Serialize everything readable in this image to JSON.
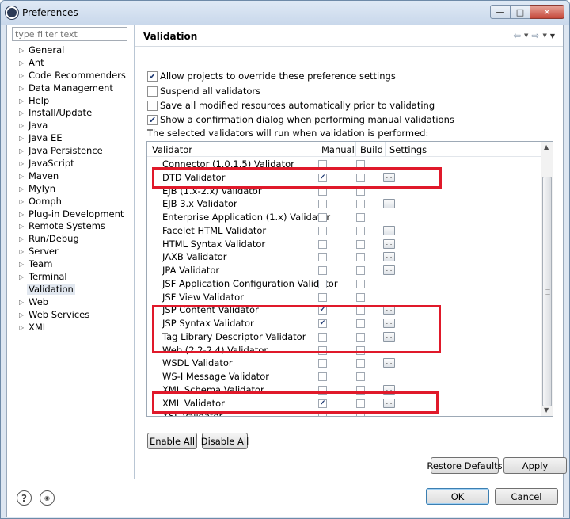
{
  "window": {
    "title": "Preferences"
  },
  "filter": {
    "placeholder": "type filter text"
  },
  "tree": [
    "General",
    "Ant",
    "Code Recommenders",
    "Data Management",
    "Help",
    "Install/Update",
    "Java",
    "Java EE",
    "Java Persistence",
    "JavaScript",
    "Maven",
    "Mylyn",
    "Oomph",
    "Plug-in Development",
    "Remote Systems",
    "Run/Debug",
    "Server",
    "Team",
    "Terminal",
    "Validation",
    "Web",
    "Web Services",
    "XML"
  ],
  "selected_tree_item": "Validation",
  "page": {
    "title": "Validation"
  },
  "options": {
    "allow_override": {
      "label": "Allow projects to override these preference settings",
      "checked": true
    },
    "suspend_all": {
      "label": "Suspend all validators",
      "checked": false
    },
    "save_all": {
      "label": "Save all modified resources automatically prior to validating",
      "checked": false
    },
    "confirm_dialog": {
      "label": "Show a confirmation dialog when performing manual validations",
      "checked": true
    },
    "info_text": "The selected validators will run when validation is performed:"
  },
  "table": {
    "headers": {
      "validator": "Validator",
      "manual": "Manual",
      "build": "Build",
      "settings": "Settings"
    },
    "rows": [
      {
        "name": "Connector (1.0,1.5) Validator",
        "manual": false,
        "build": false,
        "settings": false
      },
      {
        "name": "DTD Validator",
        "manual": true,
        "build": false,
        "settings": true
      },
      {
        "name": "EJB (1.x-2.x) Validator",
        "manual": false,
        "build": false,
        "settings": false
      },
      {
        "name": "EJB 3.x Validator",
        "manual": false,
        "build": false,
        "settings": true
      },
      {
        "name": "Enterprise Application (1.x) Validator",
        "manual": false,
        "build": false,
        "settings": false
      },
      {
        "name": "Facelet HTML Validator",
        "manual": false,
        "build": false,
        "settings": true
      },
      {
        "name": "HTML Syntax Validator",
        "manual": false,
        "build": false,
        "settings": true
      },
      {
        "name": "JAXB Validator",
        "manual": false,
        "build": false,
        "settings": true
      },
      {
        "name": "JPA Validator",
        "manual": false,
        "build": false,
        "settings": true
      },
      {
        "name": "JSF Application Configuration Validator",
        "manual": false,
        "build": false,
        "settings": false
      },
      {
        "name": "JSF View Validator",
        "manual": false,
        "build": false,
        "settings": false
      },
      {
        "name": "JSP Content Validator",
        "manual": true,
        "build": false,
        "settings": true
      },
      {
        "name": "JSP Syntax Validator",
        "manual": true,
        "build": false,
        "settings": true
      },
      {
        "name": "Tag Library Descriptor Validator",
        "manual": false,
        "build": false,
        "settings": true
      },
      {
        "name": "Web (2.2-2.4) Validator",
        "manual": false,
        "build": false,
        "settings": false
      },
      {
        "name": "WSDL Validator",
        "manual": false,
        "build": false,
        "settings": true
      },
      {
        "name": "WS-I Message Validator",
        "manual": false,
        "build": false,
        "settings": false
      },
      {
        "name": "XML Schema Validator",
        "manual": false,
        "build": false,
        "settings": true
      },
      {
        "name": "XML Validator",
        "manual": true,
        "build": false,
        "settings": true
      },
      {
        "name": "XSL Validator",
        "manual": false,
        "build": false,
        "settings": false
      }
    ]
  },
  "buttons": {
    "enable_all": "Enable All",
    "disable_all": "Disable All",
    "restore_defaults": "Restore Defaults",
    "apply": "Apply",
    "ok": "OK",
    "cancel": "Cancel"
  },
  "colors": {
    "highlight": "#e0192a",
    "accent": "#1f3a73"
  }
}
